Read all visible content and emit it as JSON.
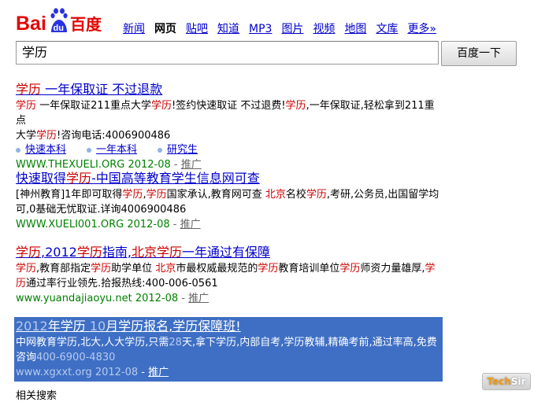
{
  "logo": {
    "text_left": "Bai",
    "text_badge": "du",
    "text_right": "百度"
  },
  "nav": {
    "items": [
      "新闻",
      "网页",
      "贴吧",
      "知道",
      "MP3",
      "图片",
      "视频",
      "地图",
      "文库"
    ],
    "current": "网页",
    "more": "更多»"
  },
  "search": {
    "value": "学历",
    "button": "百度一下"
  },
  "results": [
    {
      "title_parts": [
        "学历",
        " 一年保取证 不过退款"
      ],
      "desc_line1": [
        "学历",
        " 一年保取证211重点大学",
        "学历",
        "!签约快速取证 不过退费!",
        "学历",
        ",一年保取证,轻松拿到211重点"
      ],
      "desc_line2": [
        "大学",
        "学历",
        "!咨询电话:4006900486"
      ],
      "sublinks": [
        "快速本科",
        "一年本科",
        "研究生"
      ],
      "url": "WWW.THEXUELI.ORG 2012-08",
      "sep": " - ",
      "promo": "推广"
    },
    {
      "title_parts": [
        "快速取得",
        "学历",
        "-中国高等教育学生信息网可查"
      ],
      "desc_line1": [
        "[神州教育]1年即可取得",
        "学历",
        ",",
        "学历",
        "国家承认,教育网可查 ",
        "北京",
        "名校",
        "学历",
        ",考研,公务员,出国留学均"
      ],
      "desc_line2": [
        "可,0基础无忧取证.详询4006900486"
      ],
      "url": "WWW.XUELI001.ORG 2012-08",
      "sep": " - ",
      "promo": "推广"
    },
    {
      "title_parts": [
        "学历",
        ",2012",
        "学历",
        "指南,",
        "北京学历",
        "一年通过有保障"
      ],
      "desc_line1": [
        "学历",
        ",教育部指定",
        "学历",
        "助学单位 ",
        "北京",
        "市最权威最规范的",
        "学历",
        "教育培训单位",
        "学历",
        "师资力量雄厚,",
        "学"
      ],
      "desc_line2": [
        "历",
        "通过率行业领先.拾报热线:400-006-0561"
      ],
      "url": "www.yuandajiaoyu.net 2012-08",
      "sep": " - ",
      "promo": "推广"
    },
    {
      "title_parts": [
        "2012",
        "年学历 ",
        "10",
        "月学历报名,学历保障班!"
      ],
      "desc_line1": [
        "中网教育学历,北大,人大学历,只需",
        "28",
        "天,拿下学历,内部自考,学历教辅,精确考前,通过率高,免费"
      ],
      "desc_line2": [
        "咨询",
        "400-6900-4830"
      ],
      "url": "www.xgxxt.org 2012-08",
      "sep": " - ",
      "promo": "推广"
    }
  ],
  "watermark": {
    "t": "Tech",
    "s": "Sir"
  },
  "cut_text": "相关搜索"
}
